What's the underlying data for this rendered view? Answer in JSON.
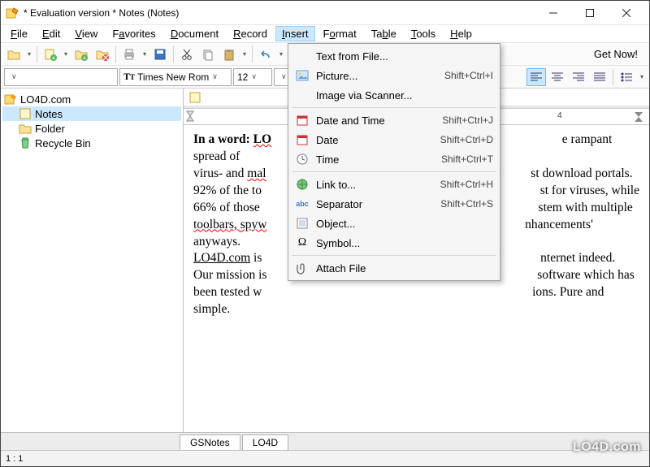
{
  "titlebar": {
    "title": "* Evaluation version * Notes (Notes)"
  },
  "menu": {
    "file": "File",
    "edit": "Edit",
    "view": "View",
    "favorites": "Favorites",
    "document": "Document",
    "record": "Record",
    "insert": "Insert",
    "format": "Format",
    "table": "Table",
    "tools": "Tools",
    "help": "Help"
  },
  "toolbar": {
    "get_now": "Get Now!"
  },
  "format_toolbar": {
    "font_name": "Times New Rom",
    "font_size": "12"
  },
  "tree": {
    "root": "LO4D.com",
    "items": {
      "notes": "Notes",
      "folder": "Folder",
      "recycle": "Recycle Bin"
    }
  },
  "ruler": {
    "mark_4": "4"
  },
  "document": {
    "line1_bold": "In a word: ",
    "line1_start": "LO",
    "line1_tail": "e rampant spread of",
    "line2_a": "virus- and ",
    "line2_b": "mal",
    "line2_tail": "st download portals.",
    "line3_a": "92% of the to",
    "line3_tail": "st for viruses, while",
    "line4_a": "66% of those",
    "line4_tail": "stem with multiple",
    "line5_a": "toolbars, ",
    "line5_b": "spyw",
    "line5_tail": "nhancements' anyways.",
    "line6_a": "LO4D.com",
    "line6_b": " is",
    "line6_tail": "nternet indeed.",
    "line7_a": "Our mission is",
    "line7_tail": " software which has",
    "line8_a": "been tested w",
    "line8_tail": "ions. Pure and simple."
  },
  "insert_menu": {
    "text_from_file": "Text from File...",
    "picture": "Picture...",
    "picture_accel": "Shift+Ctrl+I",
    "image_via_scanner": "Image via Scanner...",
    "date_time": "Date and Time",
    "date_time_accel": "Shift+Ctrl+J",
    "date": "Date",
    "date_accel": "Shift+Ctrl+D",
    "time": "Time",
    "time_accel": "Shift+Ctrl+T",
    "link_to": "Link to...",
    "link_to_accel": "Shift+Ctrl+H",
    "separator": "Separator",
    "separator_accel": "Shift+Ctrl+S",
    "object": "Object...",
    "symbol": "Symbol...",
    "attach_file": "Attach File"
  },
  "tabs": {
    "gsnotes": "GSNotes",
    "lo4d": "LO4D"
  },
  "status": {
    "pos": "1 : 1"
  },
  "watermark": "LO4D.com"
}
